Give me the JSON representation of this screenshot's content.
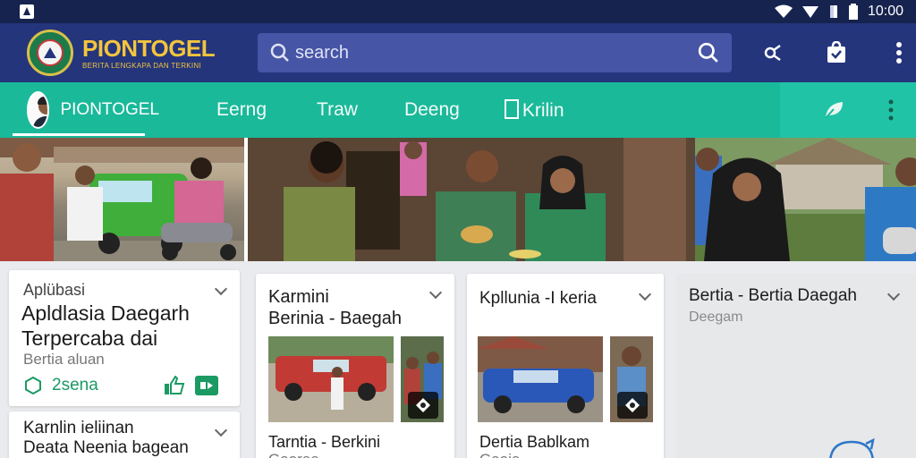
{
  "statusbar": {
    "time": "10:00"
  },
  "header": {
    "brand_title": "PIONTOGEL",
    "brand_subtitle": "BERITA LENGKAPA DAN TERKINI",
    "search_placeholder": "search"
  },
  "categories": {
    "profile_name": "PIONTOGEL",
    "tabs": [
      "Eerng",
      "Traw",
      "Deeng",
      "Krilin"
    ]
  },
  "cards": [
    {
      "kicker": "Aplübasi",
      "title_line1": "Apldlasia Daegarh",
      "title_line2": "Terpercaba dai",
      "subtitle": "Bertia aluan",
      "tag": "2sena"
    },
    {
      "title_line1": "Karmini",
      "title_line2": "Berinia - Baegah",
      "caption": "Tarntia - Berkini",
      "caption2": "Gaoree"
    },
    {
      "title_line1": "Kpllunia -I keria",
      "caption": "Dertia Bablkam",
      "caption2": "Gaoie"
    },
    {
      "title_line1": "Bertia - Bertia Daegah",
      "subtitle": "Deegam"
    },
    {
      "title_line1": "Karnlin ieliinan",
      "title_line2": "Deata Neenia bagean"
    }
  ],
  "colors": {
    "status_bar": "#16234f",
    "app_bar": "#24357c",
    "brand_gold": "#f3c53d",
    "category_bar": "#1ab99a",
    "tag_green": "#1b9a63"
  }
}
